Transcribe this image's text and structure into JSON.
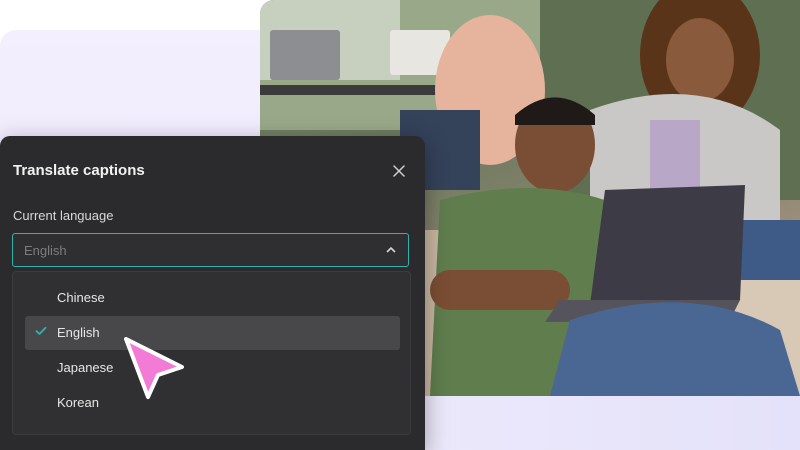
{
  "dialog": {
    "title": "Translate captions",
    "close_icon": "close-icon",
    "field_label": "Current language",
    "select": {
      "value": "English",
      "icon": "chevron-up-icon"
    },
    "options": [
      {
        "label": "Chinese",
        "selected": false
      },
      {
        "label": "English",
        "selected": true
      },
      {
        "label": "Japanese",
        "selected": false
      },
      {
        "label": "Korean",
        "selected": false
      }
    ],
    "check_icon": "check-icon"
  },
  "cursor": {
    "icon": "pointer-cursor-icon",
    "color": "#f27bd6"
  },
  "colors": {
    "dialog_bg": "#2b2b2d",
    "accent": "#2fb3ad",
    "background_tint": "#ece7fb"
  }
}
